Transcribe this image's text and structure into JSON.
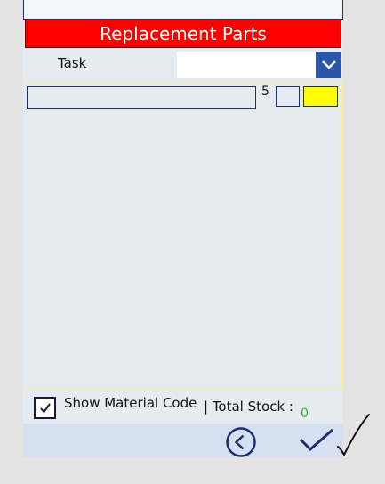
{
  "header": {
    "title": "Replacement Parts"
  },
  "task": {
    "label": "Task",
    "selected_value": ""
  },
  "gallery": {
    "items": [
      {
        "name": "",
        "quantity": "5"
      }
    ]
  },
  "footer": {
    "show_material_code_label": "Show Material Code",
    "show_material_code_checked": true,
    "total_stock_label": "| Total Stock :",
    "total_stock_value": "0"
  },
  "icons": {
    "dropdown": "chevron-down-icon",
    "back": "chevron-left-circle-icon",
    "confirm": "checkmark-icon",
    "handwritten": "handwritten-checkmark-icon"
  },
  "colors": {
    "header_bg": "#ff0000",
    "accent": "#2b55a6",
    "highlight": "#ffff00",
    "total_value": "#33b833"
  }
}
